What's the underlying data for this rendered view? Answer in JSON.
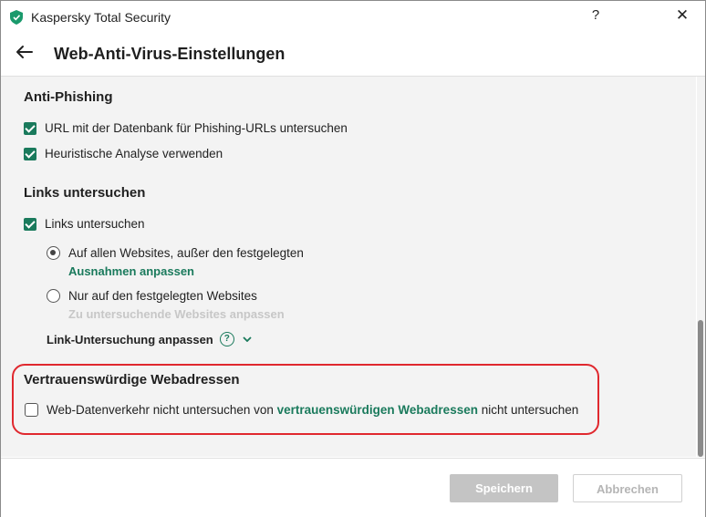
{
  "window": {
    "app_title": "Kaspersky Total Security",
    "help_label": "?",
    "close_label": "✕",
    "logo_icon": "kaspersky-shield-icon",
    "accent_color": "#1a7a5c"
  },
  "header": {
    "back_icon": "arrow-left-icon",
    "title": "Web-Anti-Virus-Einstellungen"
  },
  "anti_phishing": {
    "title": "Anti-Phishing",
    "options": [
      {
        "label": "URL mit der Datenbank für Phishing-URLs untersuchen",
        "checked": true
      },
      {
        "label": "Heuristische Analyse verwenden",
        "checked": true
      }
    ]
  },
  "links": {
    "title": "Links untersuchen",
    "check_label": "Links untersuchen",
    "checked": true,
    "radios": [
      {
        "label": "Auf allen Websites, außer den festgelegten",
        "selected": true,
        "link": "Ausnahmen anpassen",
        "link_enabled": true
      },
      {
        "label": "Nur auf den festgelegten Websites",
        "selected": false,
        "link": "Zu untersuchende Websites anpassen",
        "link_enabled": false
      }
    ],
    "customize_label": "Link-Untersuchung anpassen",
    "help_icon": "question-circle-icon",
    "expand_icon": "chevron-down-icon"
  },
  "trusted": {
    "title": "Vertrauenswürdige Webadressen",
    "text_before": "Web-Datenverkehr nicht untersuchen von ",
    "link_text": "vertrauenswürdigen Webadressen",
    "text_after": " nicht untersuchen",
    "checked": false,
    "highlight_color": "#e0282e"
  },
  "footer": {
    "save_label": "Speichern",
    "cancel_label": "Abbrechen"
  }
}
